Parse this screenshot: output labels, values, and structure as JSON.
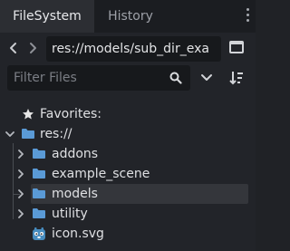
{
  "tabs": {
    "filesystem": "FileSystem",
    "history": "History"
  },
  "path": {
    "value": "res://models/sub_dir_exa"
  },
  "filter": {
    "placeholder": "Filter Files"
  },
  "tree": {
    "favorites": "Favorites:",
    "root": "res://",
    "items": [
      {
        "label": "addons"
      },
      {
        "label": "example_scene"
      },
      {
        "label": "models"
      },
      {
        "label": "utility"
      },
      {
        "label": "icon.svg"
      }
    ]
  },
  "colors": {
    "folder": "#5a9ad6",
    "selection": "#34363b",
    "star": "#e0e0e0",
    "godot_icon": "#478cbf"
  },
  "icons": {
    "back": "chevron-left-icon",
    "forward": "chevron-right-icon",
    "layout": "split-layout-icon",
    "search": "search-icon",
    "dropdown": "chevron-down-icon",
    "sort": "sort-icon",
    "favorites": "star-icon",
    "folder": "folder-icon",
    "file": "godot-icon"
  }
}
